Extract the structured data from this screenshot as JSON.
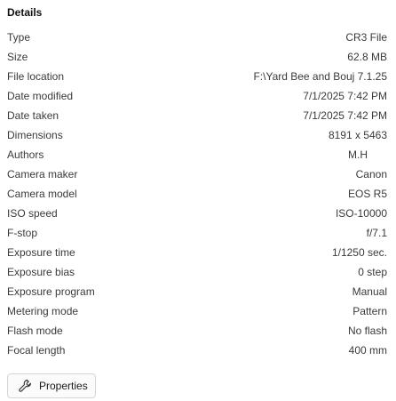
{
  "details": {
    "title": "Details",
    "rows": [
      {
        "label": "Type",
        "value": "CR3 File"
      },
      {
        "label": "Size",
        "value": "62.8 MB"
      },
      {
        "label": "File location",
        "value": "F:\\Yard Bee and Bouj 7.1.25"
      },
      {
        "label": "Date modified",
        "value": "7/1/2025 7:42 PM"
      },
      {
        "label": "Date taken",
        "value": "7/1/2025 7:42 PM"
      },
      {
        "label": "Dimensions",
        "value": "8191 x 5463"
      },
      {
        "label": "Authors",
        "value": "M.H"
      },
      {
        "label": "Camera maker",
        "value": "Canon"
      },
      {
        "label": "Camera model",
        "value": "EOS R5"
      },
      {
        "label": "ISO speed",
        "value": "ISO-10000"
      },
      {
        "label": "F-stop",
        "value": "f/7.1"
      },
      {
        "label": "Exposure time",
        "value": "1/1250 sec."
      },
      {
        "label": "Exposure bias",
        "value": "0 step"
      },
      {
        "label": "Exposure program",
        "value": "Manual"
      },
      {
        "label": "Metering mode",
        "value": "Pattern"
      },
      {
        "label": "Flash mode",
        "value": "No flash"
      },
      {
        "label": "Focal length",
        "value": "400 mm"
      }
    ]
  },
  "properties_button": {
    "label": "Properties",
    "icon": "wrench-icon"
  }
}
